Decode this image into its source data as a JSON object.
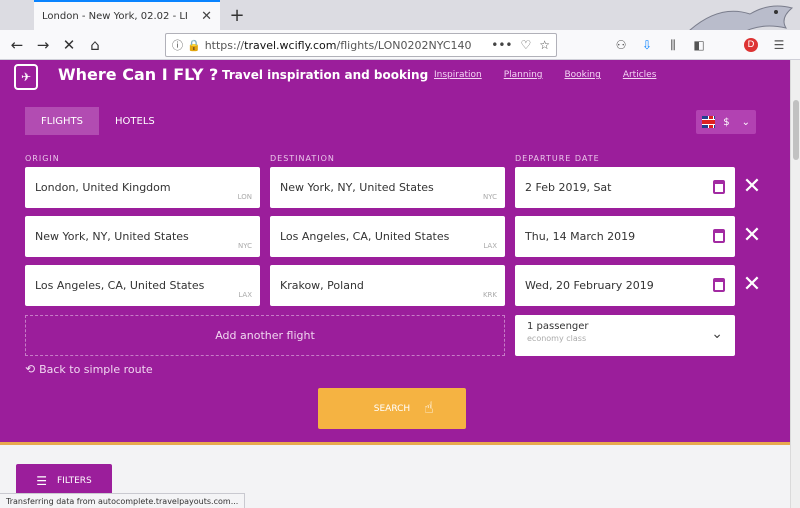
{
  "browser": {
    "tab_title": "London - New York, 02.02 - LI",
    "url_prefix": "https://",
    "url_domain": "travel.wcifly.com",
    "url_path": "/flights/LON0202NYC140",
    "status_text": "Transferring data from autocomplete.travelpayouts.com..."
  },
  "site": {
    "brand": "Where Can I FLY ?",
    "tagline": "Travel inspiration and booking",
    "nav": [
      "Inspiration",
      "Planning",
      "Booking",
      "Articles"
    ],
    "lang_currency": "$"
  },
  "mode_tabs": [
    {
      "label": "FLIGHTS",
      "active": true
    },
    {
      "label": "HOTELS",
      "active": false
    }
  ],
  "columns": {
    "origin": "ORIGIN",
    "destination": "DESTINATION",
    "departure_date": "DEPARTURE DATE"
  },
  "legs": [
    {
      "origin": "London, United Kingdom",
      "origin_code": "LON",
      "destination": "New York, NY, United States",
      "destination_code": "NYC",
      "date": "2 Feb 2019, Sat"
    },
    {
      "origin": "New York, NY, United States",
      "origin_code": "NYC",
      "destination": "Los Angeles, CA, United States",
      "destination_code": "LAX",
      "date": "Thu, 14 March 2019"
    },
    {
      "origin": "Los Angeles, CA, United States",
      "origin_code": "LAX",
      "destination": "Krakow, Poland",
      "destination_code": "KRK",
      "date": "Wed, 20 February 2019"
    }
  ],
  "add_flight_label": "Add another flight",
  "passengers": {
    "count_label": "1 passenger",
    "class_label": "economy class"
  },
  "back_link": "Back to simple route",
  "search_label": "SEARCH",
  "filters_label": "FILTERS",
  "colors": {
    "brand_purple": "#9b1e9b",
    "search_orange": "#f5b342"
  }
}
